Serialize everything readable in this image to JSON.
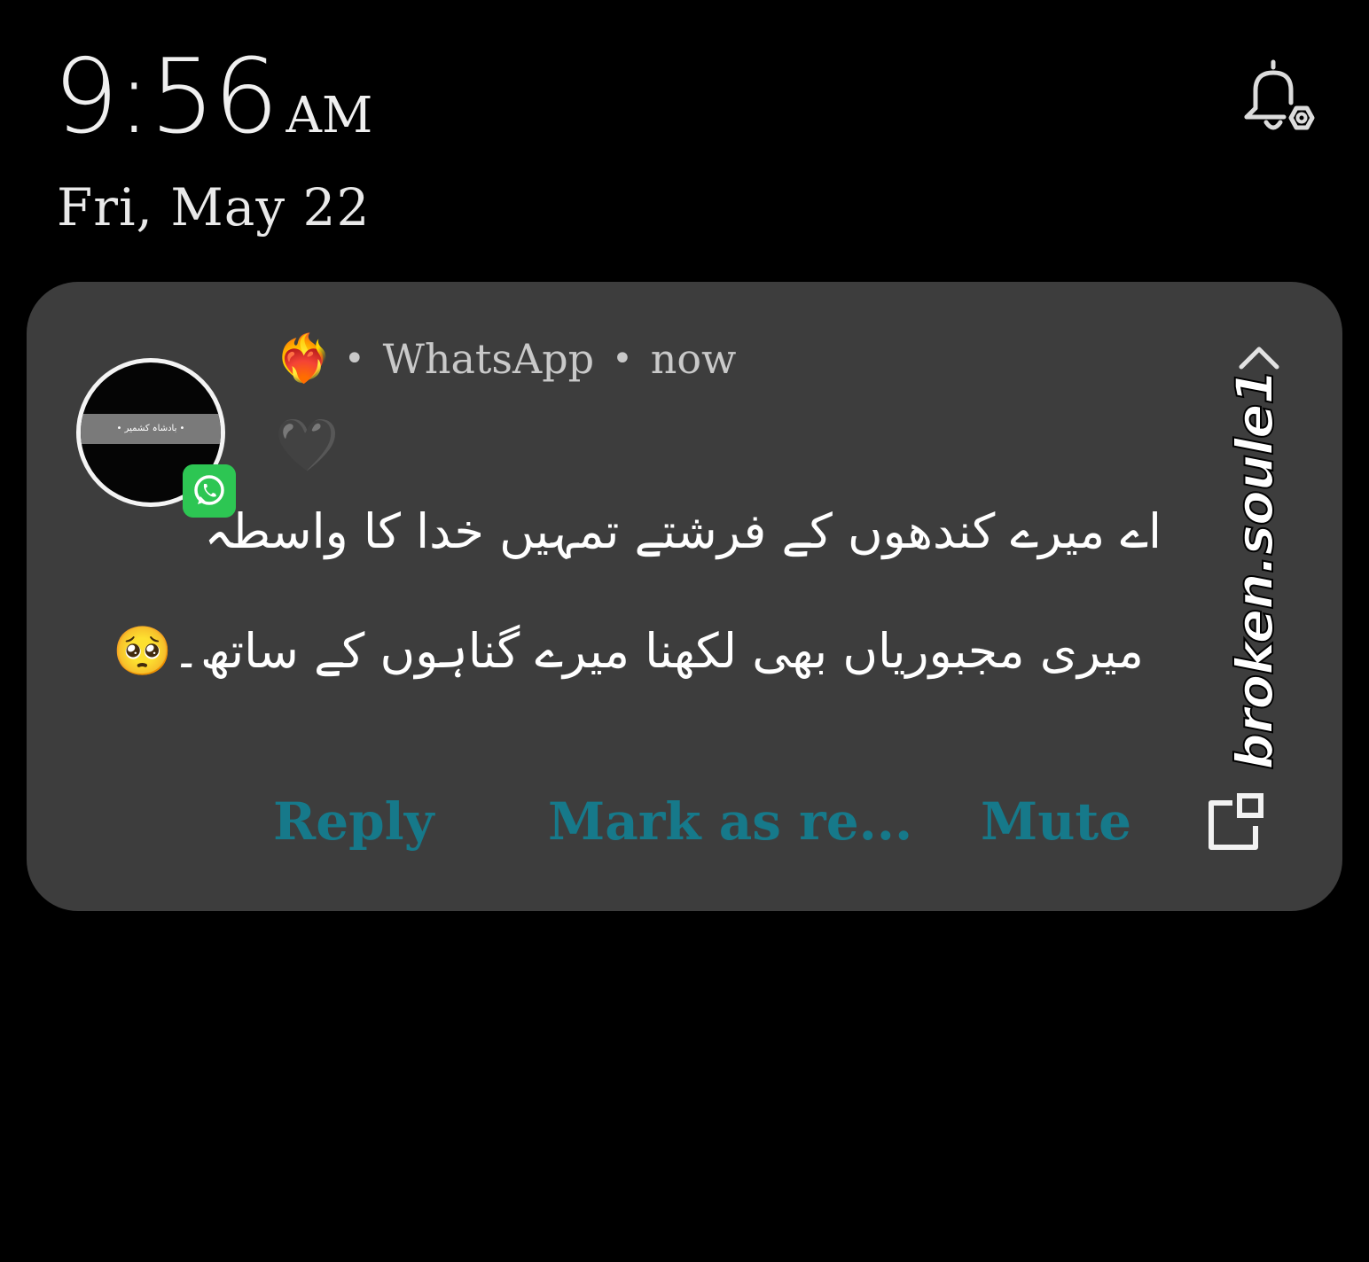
{
  "status": {
    "time": "9:56",
    "ampm": "AM",
    "date": "Fri, May 22"
  },
  "notification": {
    "sender_emoji": "❤️‍🔥",
    "app_name": "WhatsApp",
    "time_ago": "now",
    "faint_emoji": "🖤",
    "avatar_label": "• بادشاہ کشمیر •",
    "message_lines": [
      "اے میرے کندھوں کے فرشتے تمہیں خدا کا واسطہ",
      "میری مجبوریاں بھی لکھنا میرے گناہوں کے ساتھ۔🥺"
    ],
    "watermark": "broken.soule1",
    "actions": {
      "reply": "Reply",
      "mark_read": "Mark as re...",
      "mute": "Mute"
    }
  },
  "colors": {
    "background": "#000000",
    "card": "#3d3d3d",
    "action": "#16798a",
    "whatsapp_green": "#2dc653"
  },
  "icons": {
    "bell": "bell-settings-icon",
    "expand": "chevron-up-icon",
    "popout": "popout-window-icon",
    "badge": "whatsapp-icon"
  }
}
